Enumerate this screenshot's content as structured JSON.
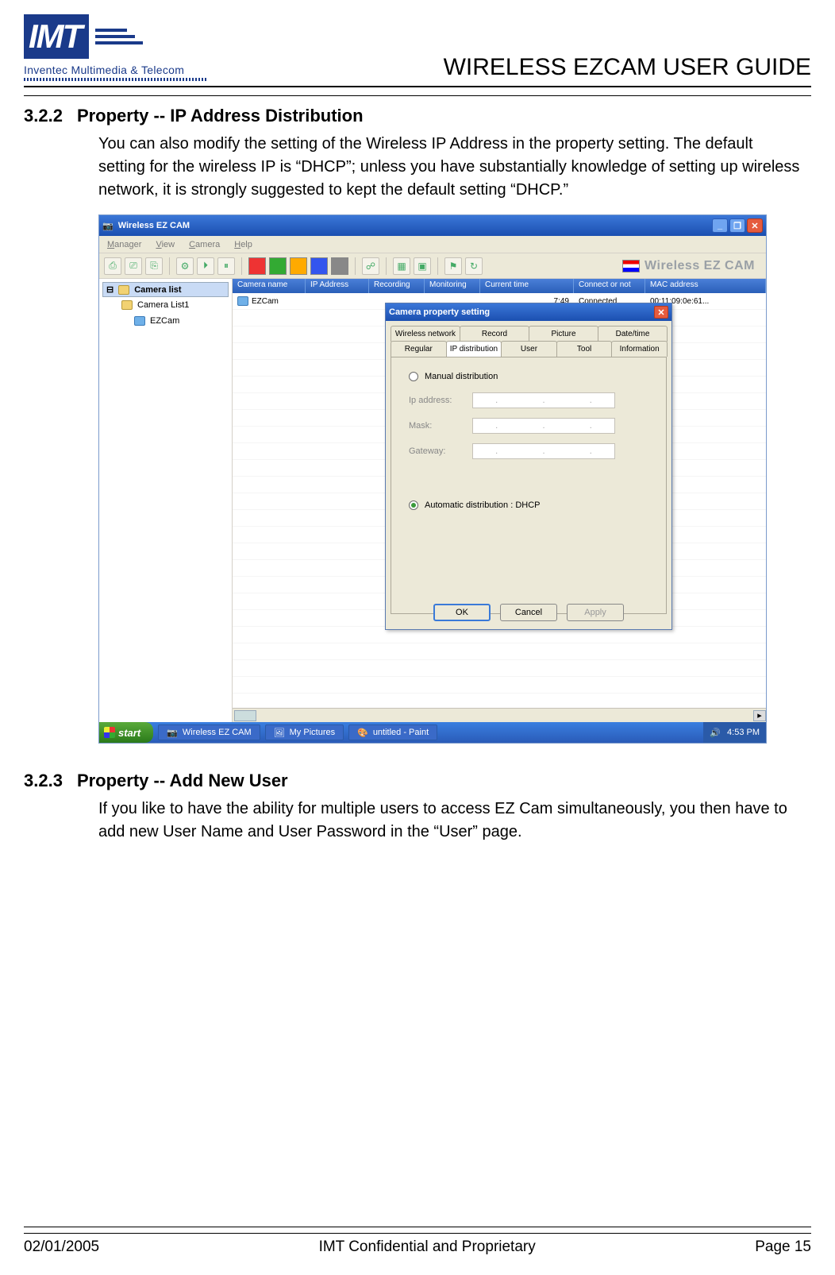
{
  "header": {
    "logo_text": "IMT",
    "logo_subtitle": "Inventec Multimedia & Telecom",
    "doc_title": "WIRELESS EZCAM USER GUIDE"
  },
  "section1": {
    "number": "3.2.2",
    "title": "Property -- IP Address Distribution",
    "body": "You can also modify the setting of the Wireless IP Address in the property setting.  The default setting for the wireless IP is “DHCP”; unless you have substantially knowledge of setting up wireless network, it is strongly suggested to kept the default setting “DHCP.”"
  },
  "section2": {
    "number": "3.2.3",
    "title": "Property -- Add New User",
    "body": "If you like to have the ability for multiple users to access EZ Cam simultaneously, you then have to add new User Name and User Password in the “User” page."
  },
  "screenshot": {
    "window_title": "Wireless EZ CAM",
    "menu": {
      "m1": "Manager",
      "m2": "View",
      "m3": "Camera",
      "m4": "Help"
    },
    "brand": "Wireless EZ CAM",
    "sidebar": {
      "root": "Camera list",
      "item1": "Camera List1",
      "item2": "EZCam"
    },
    "columns": {
      "c1": "Camera name",
      "c2": "IP Address",
      "c3": "Recording",
      "c4": "Monitoring",
      "c5": "Current time",
      "c6": "Connect or not",
      "c7": "MAC address"
    },
    "row1": {
      "name": "EZCam",
      "time": "7:49",
      "connect": "Connected",
      "mac": "00:11:09:0e:61..."
    },
    "dialog": {
      "title": "Camera property setting",
      "tabs_top": {
        "t1": "Wireless network",
        "t2": "Record",
        "t3": "Picture",
        "t4": "Date/time"
      },
      "tabs_bot": {
        "t1": "Regular",
        "t2": "IP distribution",
        "t3": "User",
        "t4": "Tool",
        "t5": "Information"
      },
      "radio_manual": "Manual distribution",
      "field_ip": "Ip address:",
      "field_mask": "Mask:",
      "field_gw": "Gateway:",
      "radio_auto": "Automatic distribution : DHCP",
      "btn_ok": "OK",
      "btn_cancel": "Cancel",
      "btn_apply": "Apply"
    },
    "taskbar": {
      "start": "start",
      "task1": "Wireless EZ CAM",
      "task2": "My Pictures",
      "task3": "untitled - Paint",
      "clock": "4:53 PM"
    }
  },
  "footer": {
    "date": "02/01/2005",
    "center": "IMT Confidential and Proprietary",
    "page": "Page 15"
  }
}
